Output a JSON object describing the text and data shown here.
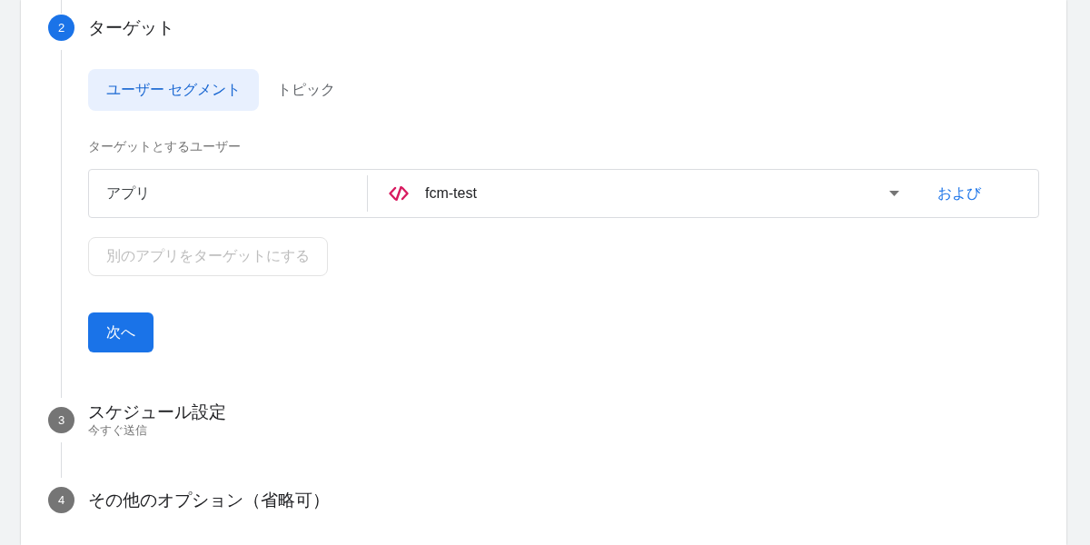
{
  "steps": [
    {
      "number": "2",
      "title": "ターゲット",
      "active": true,
      "tabs": [
        {
          "label": "ユーザー セグメント",
          "selected": true
        },
        {
          "label": "トピック",
          "selected": false
        }
      ],
      "audience_label": "ターゲットとするユーザー",
      "conditions": [
        {
          "field": "アプリ",
          "value": "fcm-test",
          "and_link": "および"
        }
      ],
      "add_app_button": {
        "label": "別のアプリをターゲットにする",
        "disabled": true
      },
      "next_button": "次へ"
    },
    {
      "number": "3",
      "title": "スケジュール設定",
      "subtitle": "今すぐ送信",
      "active": false
    },
    {
      "number": "4",
      "title": "その他のオプション（省略可）",
      "active": false
    }
  ]
}
